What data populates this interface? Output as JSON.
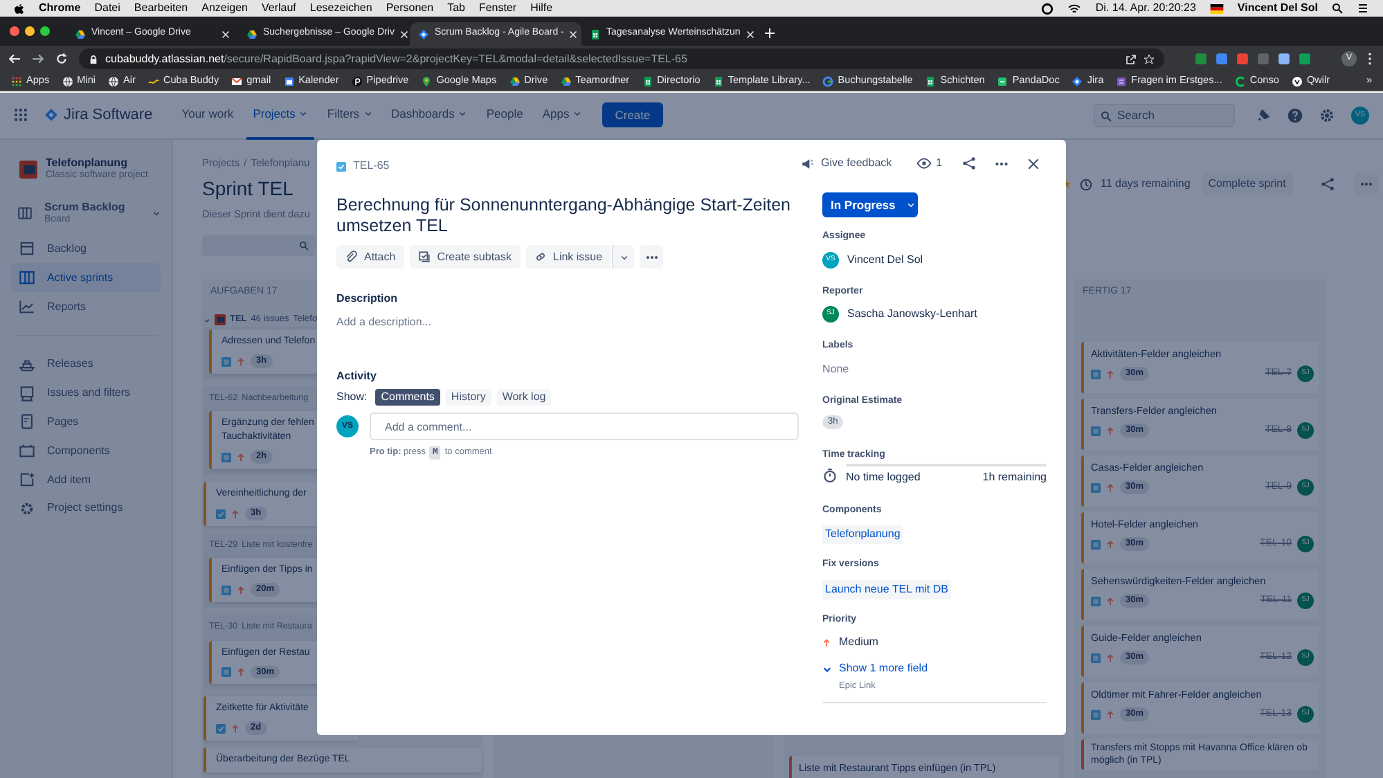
{
  "menubar": {
    "app": "Chrome",
    "menus": [
      "Datei",
      "Bearbeiten",
      "Anzeigen",
      "Verlauf",
      "Lesezeichen",
      "Personen",
      "Tab",
      "Fenster",
      "Hilfe"
    ],
    "clock": "Di. 14. Apr. 20:20:23",
    "user": "Vincent Del Sol"
  },
  "browser_tabs": [
    {
      "title": "Vincent – Google Drive",
      "selected": false
    },
    {
      "title": "Suchergebnisse – Google Driv",
      "selected": false
    },
    {
      "title": "Scrum Backlog - Agile Board -",
      "selected": true
    },
    {
      "title": "Tagesanalyse Werteinschätzun",
      "selected": false
    }
  ],
  "address": {
    "domain": "cubabuddy.atlassian.net",
    "path": "/secure/RapidBoard.jspa?rapidView=2&projectKey=TEL&modal=detail&selectedIssue=TEL-65"
  },
  "profile": "V",
  "bookmarks": [
    "Apps",
    "Mini",
    "Air",
    "Cuba Buddy",
    "gmail",
    "Kalender",
    "Pipedrive",
    "Google Maps",
    "Drive",
    "Teamordner",
    "Directorio",
    "Template Library...",
    "Buchungstabelle",
    "Schichten",
    "PandaDoc",
    "Jira",
    "Fragen im Erstges...",
    "Conso",
    "Qwilr"
  ],
  "bookmarks_more": "»",
  "jira_nav": {
    "product": "Jira Software",
    "items": [
      {
        "label": "Your work",
        "dropdown": false,
        "selected": false
      },
      {
        "label": "Projects",
        "dropdown": true,
        "selected": true
      },
      {
        "label": "Filters",
        "dropdown": true,
        "selected": false
      },
      {
        "label": "Dashboards",
        "dropdown": true,
        "selected": false
      },
      {
        "label": "People",
        "dropdown": false,
        "selected": false
      },
      {
        "label": "Apps",
        "dropdown": true,
        "selected": false
      }
    ],
    "create": "Create",
    "search_placeholder": "Search",
    "avatar": "VS"
  },
  "sidebar": {
    "project": "Telefonplanung",
    "project_type": "Classic software project",
    "board": "Scrum Backlog",
    "board_type": "Board",
    "items": [
      {
        "label": "Backlog",
        "selected": false
      },
      {
        "label": "Active sprints",
        "selected": true
      },
      {
        "label": "Reports",
        "selected": false
      }
    ],
    "more_items": [
      "Releases",
      "Issues and filters",
      "Pages",
      "Components",
      "Add item",
      "Project settings"
    ]
  },
  "board": {
    "breadcrumb": [
      "Projects",
      "Telefonplanu"
    ],
    "breadcrumb_separator": "/",
    "title": "Sprint TEL",
    "description": "Dieser Sprint dient dazu",
    "remaining": "11 days remaining",
    "complete": "Complete sprint",
    "todo_heading": "AUFGABEN 17",
    "swimlane": {
      "key": "TEL",
      "count": "46 issues",
      "name": "Telefo"
    },
    "todo_entries": [
      {
        "kind": "nested",
        "cards": [
          {
            "lines": [
              "Adressen und Telefon"
            ],
            "kind": "story",
            "estimate": "3h"
          }
        ]
      },
      {
        "kind": "nested",
        "key": "TEL-62",
        "summary": "Nachbearbeitung",
        "cards": [
          {
            "lines": [
              "Ergänzung der fehlen",
              "Tauchaktivitäten"
            ],
            "kind": "story",
            "estimate": "2h"
          }
        ]
      },
      {
        "kind": "single",
        "cards": [
          {
            "lines": [
              "Vereinheitlichung der"
            ],
            "kind": "task",
            "estimate": "3h"
          }
        ]
      },
      {
        "kind": "nested",
        "key": "TEL-29",
        "summary": "Liste mit kostenfre",
        "cards": [
          {
            "lines": [
              "Einfügen der Tipps in"
            ],
            "kind": "story",
            "estimate": "20m"
          }
        ]
      },
      {
        "kind": "nested",
        "key": "TEL-30",
        "summary": "Liste mit Restaura",
        "cards": [
          {
            "lines": [
              "Einfügen der Restau"
            ],
            "kind": "story",
            "estimate": "30m"
          }
        ]
      },
      {
        "kind": "single",
        "cards": [
          {
            "lines": [
              "Zeitkette für Aktivitäte"
            ],
            "kind": "task",
            "estimate": "2d"
          }
        ]
      },
      {
        "kind": "single",
        "cards": [
          {
            "lines": [
              "Überarbeitung der Bezüge TEL"
            ]
          }
        ]
      }
    ],
    "third_column_card": "Liste mit Restaurant Tipps einfügen (in TPL)",
    "done_heading": "FERTIG 17",
    "done_cards": [
      {
        "title": "Aktivitäten-Felder angleichen",
        "estimate": "30m",
        "key": "TEL-7",
        "resolved": true,
        "assignee": "SJ"
      },
      {
        "title": "Transfers-Felder angleichen",
        "estimate": "30m",
        "key": "TEL-8",
        "resolved": true,
        "assignee": "SJ"
      },
      {
        "title": "Casas-Felder angleichen",
        "estimate": "30m",
        "key": "TEL-9",
        "resolved": true,
        "assignee": "SJ"
      },
      {
        "title": "Hotel-Felder angleichen",
        "estimate": "30m",
        "key": "TEL-10",
        "resolved": true,
        "assignee": "SJ"
      },
      {
        "title": "Sehenswürdigkeiten-Felder angleichen",
        "estimate": "30m",
        "key": "TEL-11",
        "resolved": true,
        "assignee": "SJ"
      },
      {
        "title": "Guide-Felder angleichen",
        "estimate": "30m",
        "key": "TEL-12",
        "resolved": true,
        "assignee": "SJ"
      },
      {
        "title": "Oldtimer mit Fahrer-Felder angleichen",
        "estimate": "30m",
        "key": "TEL-13",
        "resolved": true,
        "assignee": "SJ"
      }
    ],
    "done_last_card": "Transfers mit Stopps mit Havanna Office klären ob möglich (in TPL)"
  },
  "issue": {
    "key": "TEL-65",
    "feedback": "Give feedback",
    "watchers": "1",
    "title": "Berechnung für Sonnenunntergang-Abhängige Start-Zeiten umsetzen TEL",
    "actions": [
      "Attach",
      "Create subtask",
      "Link issue"
    ],
    "description_label": "Description",
    "description_placeholder": "Add a description...",
    "activity_label": "Activity",
    "show_label": "Show:",
    "activity_tabs": [
      {
        "label": "Comments",
        "selected": true
      },
      {
        "label": "History",
        "selected": false
      },
      {
        "label": "Work log",
        "selected": false
      }
    ],
    "commenter": "VS",
    "comment_placeholder": "Add a comment...",
    "pro_tip": "**Pro tip:** press",
    "pro_tip_key": "M",
    "pro_tip_after": "to comment",
    "status": "In Progress",
    "fields": [
      {
        "kind": "person",
        "label": "Assignee",
        "value": "Vincent Del Sol",
        "initials": "VS",
        "color": "#00a3bf"
      },
      {
        "kind": "person",
        "label": "Reporter",
        "value": "Sascha Janowsky-Lenhart",
        "initials": "SJ",
        "color": "#00875a"
      },
      {
        "kind": "muted",
        "label": "Labels",
        "value": "None"
      },
      {
        "kind": "lozenge",
        "label": "Original Estimate",
        "value": "3h"
      },
      {
        "kind": "time",
        "label": "Time tracking",
        "value": "No time logged",
        "remaining": "1h remaining",
        "level": 0
      },
      {
        "kind": "tag",
        "label": "Components",
        "value": "Telefonplanung"
      },
      {
        "kind": "tag",
        "label": "Fix versions",
        "value": "Launch neue TEL mit DB"
      },
      {
        "kind": "priority",
        "label": "Priority",
        "value": "Medium"
      }
    ],
    "more_fields": "Show 1 more field",
    "more_hint": "Epic Link"
  }
}
